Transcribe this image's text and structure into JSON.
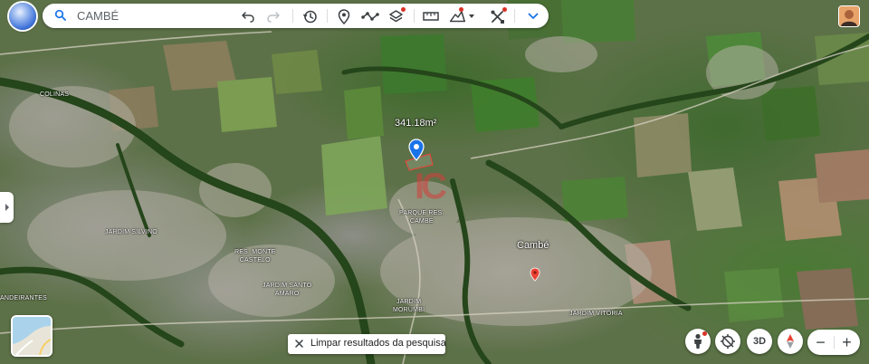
{
  "search": {
    "value": "CAMBÉ"
  },
  "colors": {
    "accent": "#1a73e8",
    "marker_blue": "#1a73e8",
    "marker_red": "#ea4335",
    "notify_dot": "#d93025"
  },
  "toolbar": {
    "icons": [
      "undo-icon",
      "redo-icon",
      "history-icon",
      "place-marker-icon",
      "path-icon",
      "layers-icon",
      "ruler-icon",
      "elevation-icon",
      "tools-icon",
      "expand-icon"
    ]
  },
  "map": {
    "measurement": "341.18m²",
    "city_label": "Cambé",
    "places": [
      {
        "id": "colinas",
        "text": "COLINAS"
      },
      {
        "id": "parque-res-cambe",
        "text": "PARQUE RES.\nCAMBÉ"
      },
      {
        "id": "jardim-silvino",
        "text": "JARDIM SILVINO"
      },
      {
        "id": "res-monte-castelo",
        "text": "RES. MONTE\nCASTELO"
      },
      {
        "id": "jardim-santo-amaro",
        "text": "JARDIM SANTO\nAMARO"
      },
      {
        "id": "jardim-morumbi",
        "text": "JARDIM\nMORUMBI"
      },
      {
        "id": "jardim-vitoria",
        "text": "JARDIM VITÓRIA"
      },
      {
        "id": "bandeirantes",
        "text": "ANDEIRANTES"
      }
    ],
    "watermark": "IC"
  },
  "clear_results": {
    "label": "Limpar resultados da pesquisa"
  },
  "controls": {
    "three_d": "3D",
    "zoom_out": "−",
    "zoom_in": "+"
  }
}
